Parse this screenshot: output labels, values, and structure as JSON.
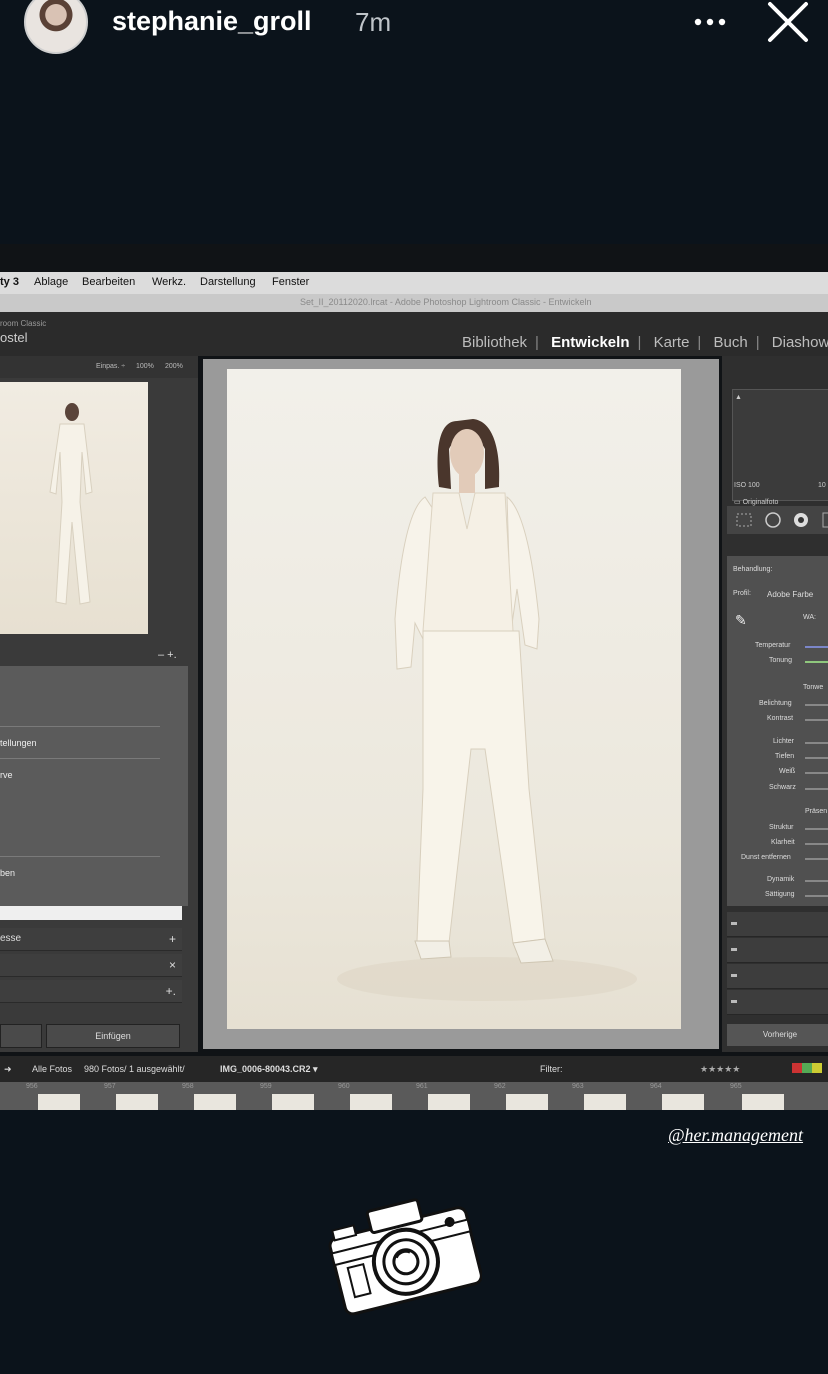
{
  "story": {
    "username": "stephanie_groll",
    "time": "7m",
    "mention": "@her.management"
  },
  "lightroom": {
    "menubar": [
      "ty 3",
      "Ablage",
      "Bearbeiten",
      "Werkz.",
      "Darstellung",
      "Fenster"
    ],
    "window_title": "Set_II_20112020.lrcat - Adobe Photoshop Lightroom Classic - Entwickeln",
    "brand_small": "room Classic",
    "brand_big": "ostel",
    "modules": [
      "Bibliothek",
      "Entwickeln",
      "Karte",
      "Buch",
      "Diashow"
    ],
    "active_module": "Entwickeln",
    "navigator": {
      "fit": "Einpas. ÷",
      "zoom1": "100%",
      "zoom2": "200%"
    },
    "presets": {
      "items": [
        "tellungen",
        "rve",
        "ben"
      ]
    },
    "left_rows": [
      {
        "label": "esse",
        "symbol": "+"
      },
      {
        "label": "",
        "symbol": "×"
      },
      {
        "label": "",
        "symbol": "+."
      }
    ],
    "paste_button": "Einfügen",
    "histogram_info": {
      "iso": "ISO 100",
      "iso_right": "10",
      "original": "Originalfoto"
    },
    "basic": {
      "treatment": "Behandlung:",
      "profile_label": "Profil:",
      "profile_value": "Adobe Farbe",
      "wb_label": "WA:",
      "temperature": "Temperatur",
      "tint": "Tonung",
      "tone": "Tonwe",
      "exposure": "Belichtung",
      "contrast": "Kontrast",
      "highlights": "Lichter",
      "shadows": "Tiefen",
      "whites": "Weiß",
      "blacks": "Schwarz",
      "presence": "Präsen",
      "texture": "Struktur",
      "clarity": "Klarheit",
      "dehaze": "Dunst entfernen",
      "vibrance": "Dynamik",
      "saturation": "Sättigung"
    },
    "previous_button": "Vorherige",
    "bottom": {
      "source": "Alle Fotos",
      "count": "980 Fotos/ 1 ausgewählt/",
      "filename": "IMG_0006-80043.CR2 ▾",
      "filter": "Filter:",
      "stars": "★★★★★"
    },
    "filmstrip_numbers": [
      "956",
      "957",
      "958",
      "959",
      "960",
      "961",
      "962",
      "963",
      "964",
      "965"
    ]
  }
}
